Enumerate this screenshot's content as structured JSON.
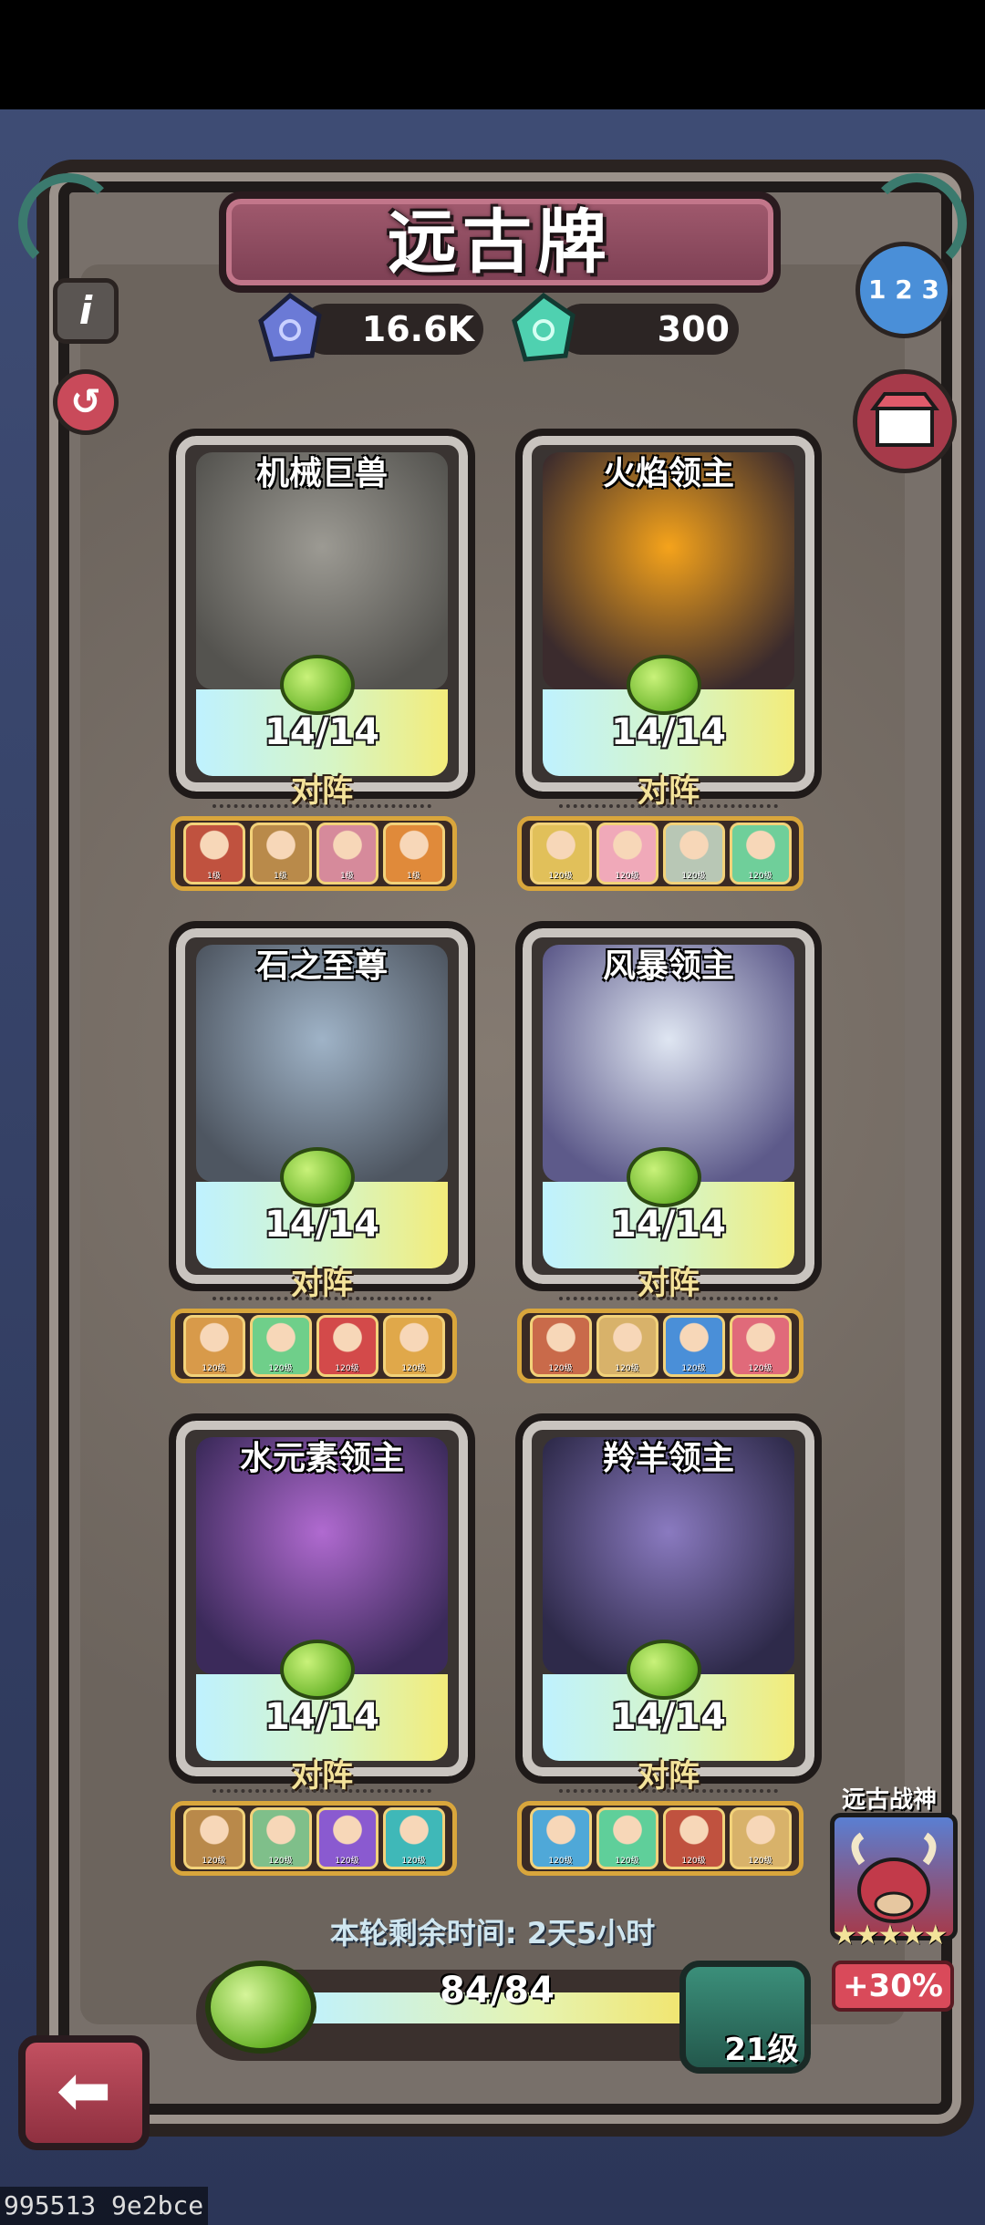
{
  "header": {
    "title": "远古牌"
  },
  "resources": [
    {
      "icon": "blue-crystal-icon",
      "value": "16.6K",
      "color": "#6b7ad6"
    },
    {
      "icon": "green-crystal-icon",
      "value": "300",
      "color": "#4fd1b0"
    }
  ],
  "side_buttons": {
    "info": "i",
    "history": "↺",
    "ranking": "1 2 3",
    "shop": "shop-icon"
  },
  "cards": [
    {
      "name": "机械巨兽",
      "count": "14/14",
      "vs": "对阵",
      "art": [
        "#9c9a93",
        "#54534f"
      ],
      "team": [
        {
          "c": "#c0523f",
          "lv": "1级"
        },
        {
          "c": "#b98a4a",
          "lv": "1级"
        },
        {
          "c": "#d68a9b",
          "lv": "1级"
        },
        {
          "c": "#e08a3a",
          "lv": "1级"
        }
      ]
    },
    {
      "name": "火焰领主",
      "count": "14/14",
      "vs": "对阵",
      "art": [
        "#f5a31b",
        "#3b2b2d"
      ],
      "team": [
        {
          "c": "#e1c05a",
          "lv": "120级"
        },
        {
          "c": "#f0a9b9",
          "lv": "120级"
        },
        {
          "c": "#b8c7b5",
          "lv": "120级"
        },
        {
          "c": "#6fcf9a",
          "lv": "120级"
        }
      ]
    },
    {
      "name": "石之至尊",
      "count": "14/14",
      "vs": "对阵",
      "art": [
        "#9fb3c7",
        "#4e5661"
      ],
      "team": [
        {
          "c": "#d89a4a",
          "lv": "120级"
        },
        {
          "c": "#6fcf8a",
          "lv": "120级"
        },
        {
          "c": "#d34a4a",
          "lv": "120级"
        },
        {
          "c": "#e0a84a",
          "lv": "120级"
        }
      ]
    },
    {
      "name": "风暴领主",
      "count": "14/14",
      "vs": "对阵",
      "art": [
        "#dfe6f2",
        "#5d5a8a"
      ],
      "team": [
        {
          "c": "#c96a4a",
          "lv": "120级"
        },
        {
          "c": "#d8b26a",
          "lv": "120级"
        },
        {
          "c": "#4a8fd8",
          "lv": "120级"
        },
        {
          "c": "#e06a7a",
          "lv": "120级"
        }
      ]
    },
    {
      "name": "水元素领主",
      "count": "14/14",
      "vs": "对阵",
      "art": [
        "#b06ad0",
        "#3b2a5a"
      ],
      "team": [
        {
          "c": "#b9894a",
          "lv": "120级"
        },
        {
          "c": "#7fbf8a",
          "lv": "120级"
        },
        {
          "c": "#8a5ad0",
          "lv": "120级"
        },
        {
          "c": "#3fb8b8",
          "lv": "120级"
        }
      ]
    },
    {
      "name": "羚羊领主",
      "count": "14/14",
      "vs": "对阵",
      "art": [
        "#8a7ac0",
        "#2e2a4a"
      ],
      "team": [
        {
          "c": "#4fa8d8",
          "lv": "120级"
        },
        {
          "c": "#5fcf9a",
          "lv": "120级"
        },
        {
          "c": "#c0523f",
          "lv": "120级"
        },
        {
          "c": "#d8b26a",
          "lv": "120级"
        }
      ]
    }
  ],
  "footer": {
    "timer_text": "本轮剩余时间: 2天5小时",
    "progress_text": "84/84",
    "progress": 1.0,
    "level_text": "21级"
  },
  "ancient_god": {
    "title": "远古战神",
    "stars": "★★★★★",
    "star_count": 5,
    "bonus": "+30%"
  },
  "watermark": "995513 9e2bce"
}
